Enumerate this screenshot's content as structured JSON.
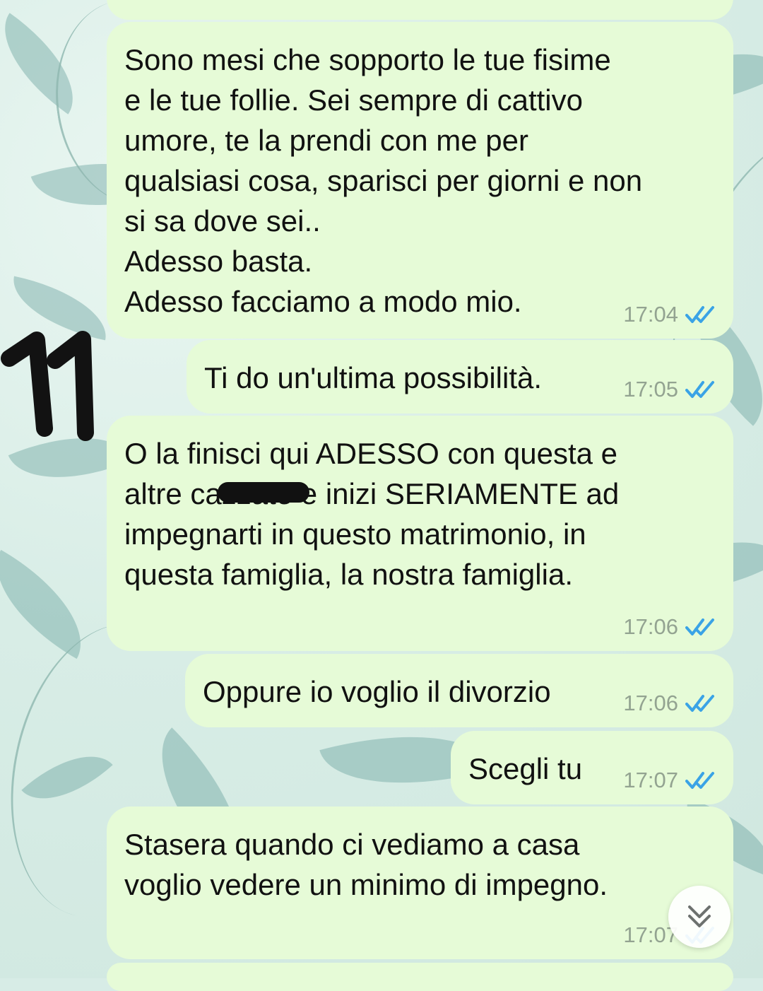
{
  "conversation": {
    "messages": [
      {
        "text": "Sono mesi che sopporto le tue fisime\ne le tue follie. Sei sempre di cattivo\numore, te la prendi con me per\nqualsiasi cosa, sparisci per giorni e non\nsi sa dove sei..\nAdesso basta.\nAdesso facciamo a modo mio.",
        "time": "17:04"
      },
      {
        "text": "Ti do un'ultima possibilità.",
        "time": "17:05"
      },
      {
        "text": "O la finisci qui ADESSO con questa e\naltre cazzate e inizi SERIAMENTE ad\nimpegnarti in questo matrimonio, in\nquesta famiglia, la nostra famiglia.",
        "time": "17:06"
      },
      {
        "text": "Oppure io voglio il divorzio",
        "time": "17:06"
      },
      {
        "text": "Scegli tu",
        "time": "17:07"
      },
      {
        "text": "Stasera quando ci vediamo a casa\nvoglio vedere un minimo di impegno.",
        "time": "17:07"
      }
    ]
  },
  "annotation": {
    "number": "11"
  },
  "controls": {
    "scroll_down_icon": "chevron-double-down-icon"
  },
  "colors": {
    "bubble": "#e6fbd7",
    "text": "#111111",
    "time": "#93a391",
    "read_ticks": "#3aa3e6"
  }
}
